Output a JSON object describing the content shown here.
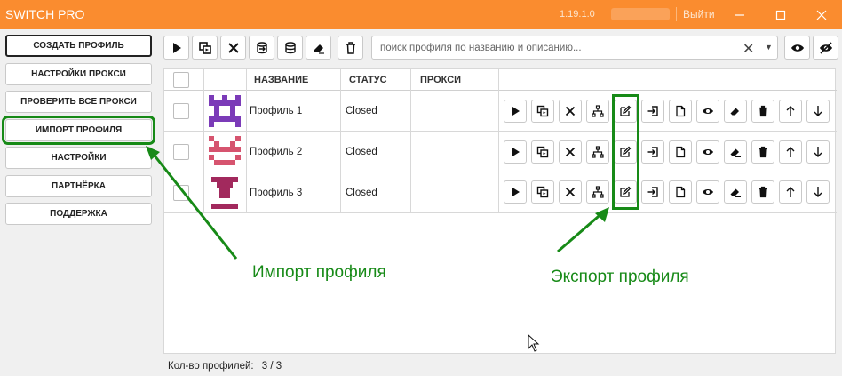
{
  "window": {
    "title": "SWITCH PRO",
    "version": "1.19.1.0",
    "logout_label": "Выйти"
  },
  "sidebar": {
    "items": [
      {
        "label": "СОЗДАТЬ ПРОФИЛЬ"
      },
      {
        "label": "НАСТРОЙКИ ПРОКСИ"
      },
      {
        "label": "ПРОВЕРИТЬ ВСЕ ПРОКСИ"
      },
      {
        "label": "ИМПОРТ ПРОФИЛЯ"
      },
      {
        "label": "НАСТРОЙКИ"
      },
      {
        "label": "ПАРТНЁРКА"
      },
      {
        "label": "ПОДДЕРЖКА"
      }
    ]
  },
  "toolbar": {
    "buttons": [
      "play-icon",
      "copy-icon",
      "close-icon",
      "database-export-icon",
      "database-icon",
      "eraser-icon",
      "trash-icon"
    ],
    "search_placeholder": "поиск профиля по названию и описанию...",
    "eye_icon": "eye-icon",
    "eye_off_icon": "eye-off-icon"
  },
  "table": {
    "columns": [
      "НАЗВАНИЕ",
      "СТАТУС",
      "ПРОКСИ"
    ],
    "rows": [
      {
        "name": "Профиль 1",
        "status": "Closed",
        "proxy": "",
        "avatar_color": "#7b3bb8"
      },
      {
        "name": "Профиль 2",
        "status": "Closed",
        "proxy": "",
        "avatar_color": "#d6546f"
      },
      {
        "name": "Профиль 3",
        "status": "Closed",
        "proxy": "",
        "avatar_color": "#a2295d"
      }
    ],
    "row_actions": [
      "play-icon",
      "copy-icon",
      "close-icon",
      "network-icon",
      "edit-export-icon",
      "login-icon",
      "file-icon",
      "eye-icon",
      "eraser-icon",
      "trash-icon",
      "arrow-up-icon",
      "arrow-down-icon"
    ]
  },
  "annotations": {
    "import_note": "Импорт профиля",
    "export_note": "Экспорт профиля",
    "highlight_color": "#178a17"
  },
  "status_bar": {
    "label": "Кол-во профилей:",
    "value": "3  /  3"
  },
  "colors": {
    "titlebar": "#fa8c2f"
  }
}
